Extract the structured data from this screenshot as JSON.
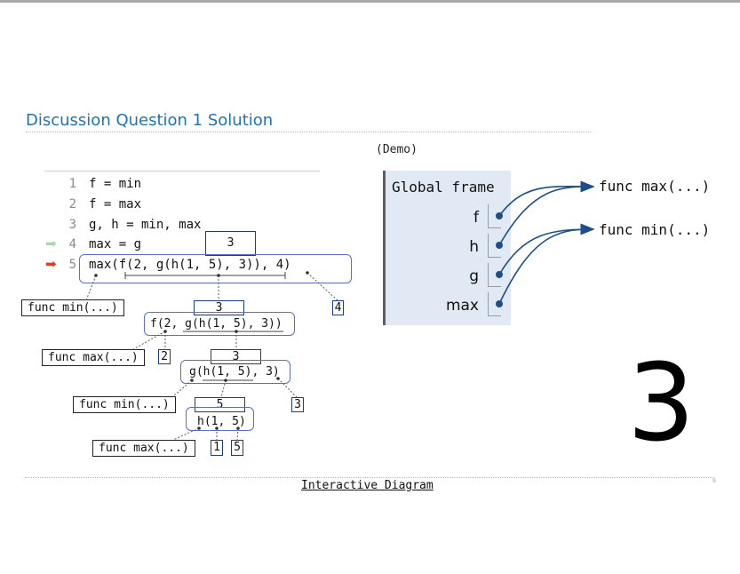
{
  "title": "Discussion Question 1 Solution",
  "demo_label": "(Demo)",
  "code": [
    {
      "num": "1",
      "text": "f = min"
    },
    {
      "num": "2",
      "text": "f = max"
    },
    {
      "num": "3",
      "text": "g, h = min, max"
    },
    {
      "num": "4",
      "text": "max = g"
    },
    {
      "num": "5",
      "text": "max(f(2, g(h(1, 5), 3)), 4)"
    }
  ],
  "arrows": {
    "previous": "➡",
    "current": "➡"
  },
  "global_frame": {
    "label": "Global frame",
    "vars": [
      "f",
      "h",
      "g",
      "max"
    ]
  },
  "functions": {
    "max": "func max(...)",
    "min": "func min(...)"
  },
  "result": "3",
  "tree": {
    "root_value": "3",
    "root_func": "func min(...)",
    "root_arg": "4",
    "f_value": "3",
    "f_expr": "f(2, g(h(1, 5), 3))",
    "f_func": "func max(...)",
    "f_arg": "2",
    "g_value": "3",
    "g_expr": "g(h(1, 5), 3)",
    "g_func": "func min(...)",
    "g_arg": "3",
    "h_value": "5",
    "h_expr": "h(1, 5)",
    "h_func": "func max(...)",
    "h_arg1": "1",
    "h_arg2": "5"
  },
  "footer_link": "Interactive Diagram",
  "page_number": "9"
}
